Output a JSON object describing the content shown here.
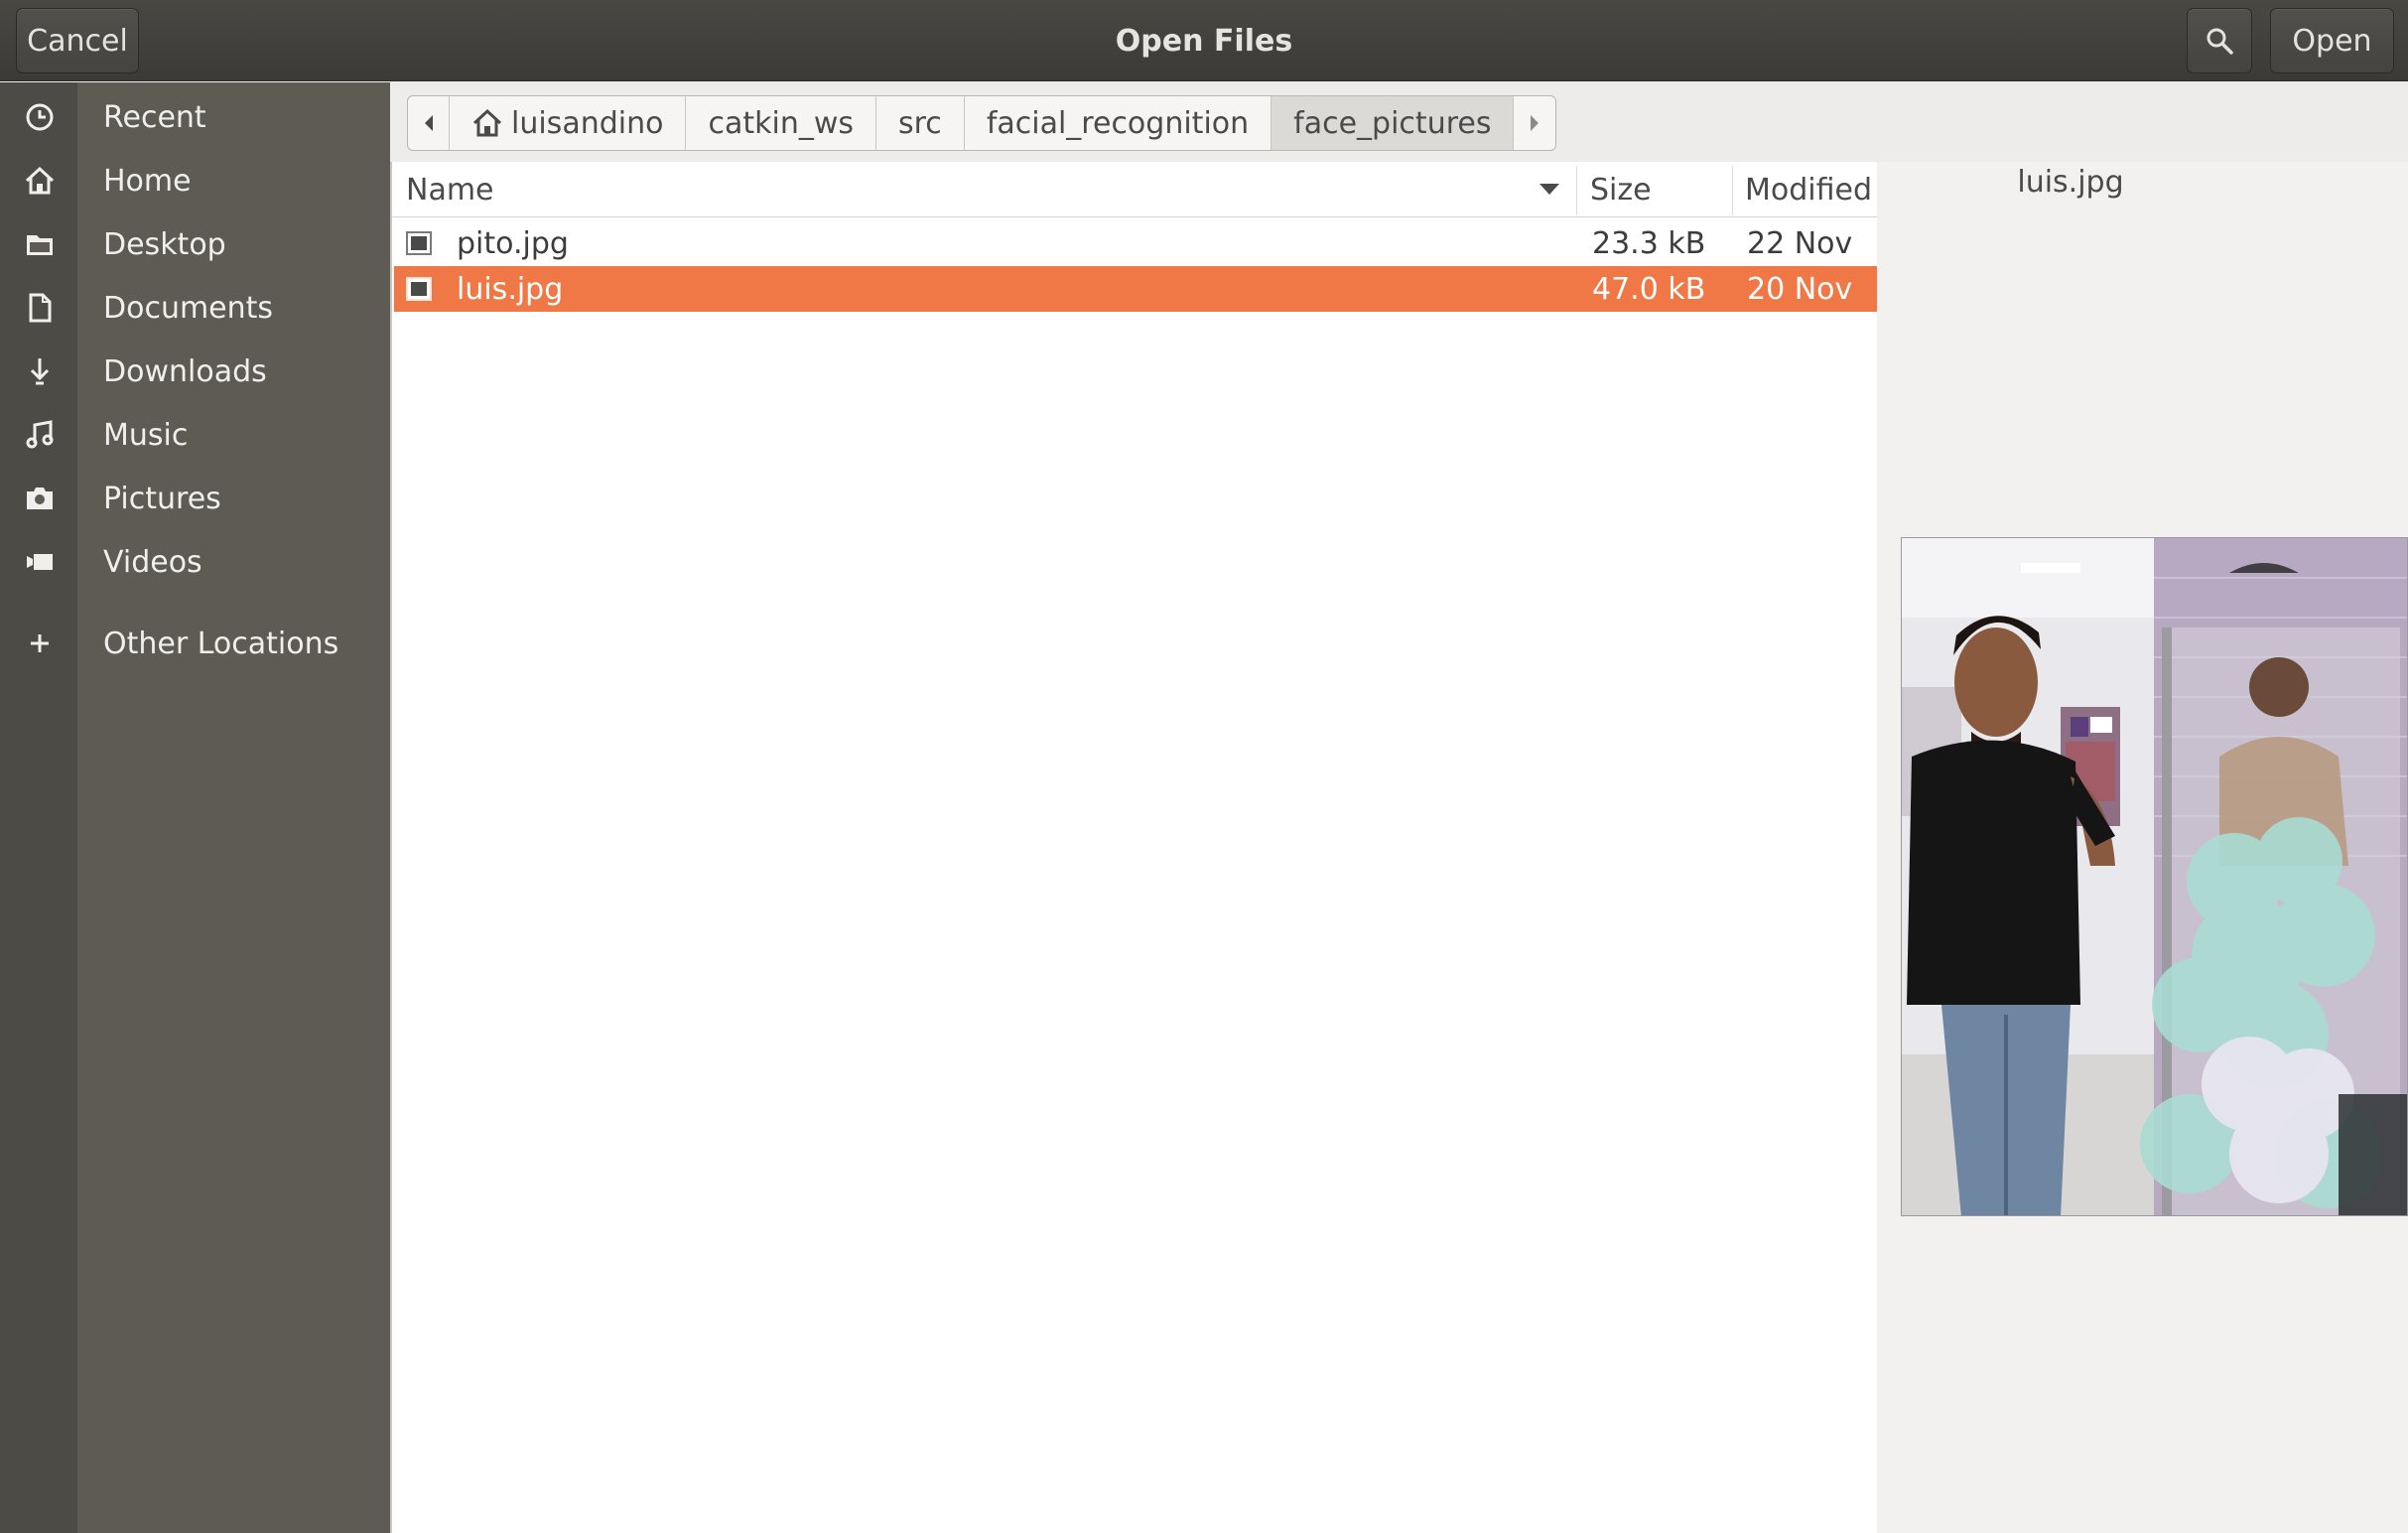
{
  "dialog": {
    "title": "Open Files",
    "cancel_label": "Cancel",
    "open_label": "Open",
    "search_icon": "search-icon"
  },
  "sidebar": {
    "items": [
      {
        "label": "Recent",
        "icon": "clock-icon"
      },
      {
        "label": "Home",
        "icon": "home-icon"
      },
      {
        "label": "Desktop",
        "icon": "folder-icon"
      },
      {
        "label": "Documents",
        "icon": "document-icon"
      },
      {
        "label": "Downloads",
        "icon": "download-icon"
      },
      {
        "label": "Music",
        "icon": "music-icon"
      },
      {
        "label": "Pictures",
        "icon": "camera-icon"
      },
      {
        "label": "Videos",
        "icon": "video-icon"
      },
      {
        "label": "Other Locations",
        "icon": "plus-icon"
      }
    ]
  },
  "pathbar": {
    "crumbs": [
      "luisandino",
      "catkin_ws",
      "src",
      "facial_recognition",
      "face_pictures"
    ],
    "active_index": 4
  },
  "filelist": {
    "columns": {
      "name": "Name",
      "size": "Size",
      "modified": "Modified"
    },
    "rows": [
      {
        "name": "pito.jpg",
        "size": "23.3 kB",
        "modified": "22 Nov",
        "selected": false
      },
      {
        "name": "luis.jpg",
        "size": "47.0 kB",
        "modified": "20 Nov",
        "selected": true
      }
    ]
  },
  "preview": {
    "filename": "luis.jpg",
    "image_subject": "photo of a smiling man standing next to a shower display in a store"
  },
  "colors": {
    "selection": "#f07746",
    "sidebar": "#5d5b53",
    "headerbar": "#3f3e3a"
  }
}
